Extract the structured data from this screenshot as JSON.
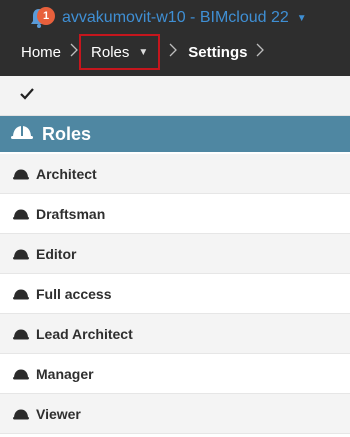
{
  "header": {
    "notification_count": "1",
    "server_title": "avvakumovit-w10 - BIMcloud 22",
    "accent_color": "#3f8fd4",
    "badge_color": "#e8603c"
  },
  "breadcrumb": {
    "home": "Home",
    "roles": "Roles",
    "settings": "Settings"
  },
  "section": {
    "title": "Roles",
    "header_color": "#4f87a2"
  },
  "roles": [
    {
      "label": "Architect"
    },
    {
      "label": "Draftsman"
    },
    {
      "label": "Editor"
    },
    {
      "label": "Full access"
    },
    {
      "label": "Lead Architect"
    },
    {
      "label": "Manager"
    },
    {
      "label": "Viewer"
    }
  ],
  "icons": {
    "notification": "bell-icon",
    "role": "hard-hat-icon",
    "check": "checkmark-icon"
  }
}
